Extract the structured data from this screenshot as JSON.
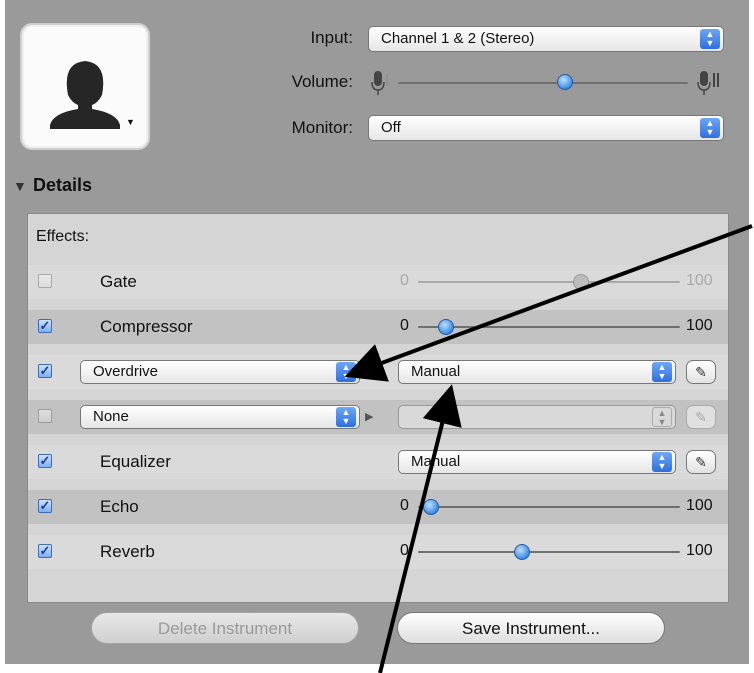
{
  "input": {
    "label": "Input:",
    "value": "Channel 1 & 2 (Stereo)"
  },
  "volume": {
    "label": "Volume:",
    "level": 0.58
  },
  "monitor": {
    "label": "Monitor:",
    "value": "Off"
  },
  "details": {
    "title": "Details"
  },
  "effects": {
    "header": "Effects:",
    "rows": [
      {
        "name": "Gate",
        "checked": false,
        "min": "0",
        "max": "100",
        "level": 0.63,
        "disabled": true
      },
      {
        "name": "Compressor",
        "checked": true,
        "min": "0",
        "max": "100",
        "level": 0.08
      },
      {
        "name": "Overdrive",
        "checked": true,
        "preset": "Manual"
      },
      {
        "name": "None",
        "checked": false,
        "preset": ""
      },
      {
        "name": "Equalizer",
        "checked": true,
        "preset": "Manual"
      },
      {
        "name": "Echo",
        "checked": true,
        "min": "0",
        "max": "100",
        "level": 0.02
      },
      {
        "name": "Reverb",
        "checked": true,
        "min": "0",
        "max": "100",
        "level": 0.39
      }
    ]
  },
  "buttons": {
    "delete": "Delete Instrument",
    "save": "Save Instrument..."
  },
  "colors": {
    "accent": "#3a8de8",
    "panel": "#9a9a9a"
  }
}
